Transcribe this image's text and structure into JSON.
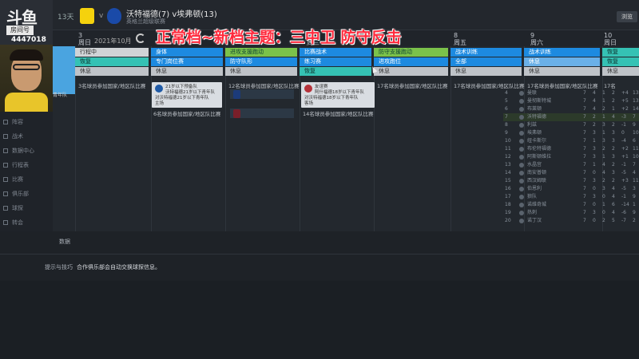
{
  "stream": {
    "site_logo": "斗鱼",
    "room_label": "房间号",
    "room_number": "4447018"
  },
  "header": {
    "days_label": "13天",
    "vs_label": "v",
    "match_title": "沃特福德(7) v埃弗顿(13)",
    "match_sub": "英格兰超级联赛",
    "browse_button": "浏览",
    "home_color": "#f5d20d",
    "away_color": "#1a4aa8"
  },
  "overlay": {
    "title": "正常档~新档主题：三中卫 防守反击",
    "color": "#ff2a3c"
  },
  "calendar": {
    "month": "2021年10月",
    "days": [
      {
        "num": "3",
        "weekday": "周日"
      },
      {
        "num": "6",
        "weekday": "周三"
      },
      {
        "num": "8",
        "weekday": "周五"
      },
      {
        "num": "9",
        "weekday": "周六"
      },
      {
        "num": "10",
        "weekday": "周日"
      }
    ],
    "faint_header": "6项数据"
  },
  "schedule": {
    "col0": [
      "行程中",
      "恢复",
      "休息"
    ],
    "col1": [
      "身体",
      "专门岗位赛",
      "休息"
    ],
    "col2": [
      "进攻支援跑动",
      "防守队形",
      "休息"
    ],
    "col3": [
      "比赛战术",
      "练习赛",
      "恢复"
    ],
    "col4": [
      "防守支援跑动",
      "进攻跑位",
      "休息"
    ],
    "col5": [
      "战术训练",
      "全部",
      "休息"
    ],
    "col6": [
      "战术训练",
      "休息",
      "休息"
    ],
    "col7": [
      "恢复",
      "恢复",
      "休息"
    ]
  },
  "info_rows": {
    "r0": "3名球员参加国家/地区队比赛",
    "r1": "12名球员参加国家/地区队比赛",
    "r2": "17名球员参加国家/地区队比赛",
    "r3": "17名球员参加国家/地区队比赛",
    "r4": "17名球员参加国家/地区队比赛",
    "r5": "17名球员参加国家/地区队比赛",
    "r6": "17名"
  },
  "popups": {
    "p1_line1": "21岁以下预备队",
    "p1_line2": "沃特福德21岁以下青年队",
    "p1_line3": "对沃特福德21岁以下青年队",
    "p1_line4": "主场",
    "p1_footer": "6名球员参加国家/地区队比赛",
    "p2_line1": "友谊赛",
    "p2_line2": "阿什福德18岁以下青年队",
    "p2_line3": "对沃特福德18岁以下青年队",
    "p2_line4": "客场",
    "p2_footer": "14名球员参加国家/地区队比赛"
  },
  "sidebar": {
    "selected_label": "青年队",
    "items": [
      "阵容",
      "战术",
      "数据中心",
      "行程表",
      "比赛",
      "俱乐部",
      "球探",
      "转会"
    ]
  },
  "league_table": {
    "rows": [
      {
        "pos": "4",
        "team": "曼联",
        "p": "7",
        "w": "4",
        "d": "1",
        "l": "2",
        "gd": "+4",
        "pts": "13"
      },
      {
        "pos": "5",
        "team": "曼彻斯特城",
        "p": "7",
        "w": "4",
        "d": "1",
        "l": "2",
        "gd": "+5",
        "pts": "13"
      },
      {
        "pos": "6",
        "team": "布莱顿",
        "p": "7",
        "w": "4",
        "d": "2",
        "l": "1",
        "gd": "+2",
        "pts": "14"
      },
      {
        "pos": "7",
        "team": "沃特福德",
        "p": "7",
        "w": "2",
        "d": "1",
        "l": "4",
        "gd": "-3",
        "pts": "7"
      },
      {
        "pos": "8",
        "team": "利兹",
        "p": "7",
        "w": "2",
        "d": "3",
        "l": "2",
        "gd": "-1",
        "pts": "9"
      },
      {
        "pos": "9",
        "team": "埃弗顿",
        "p": "7",
        "w": "3",
        "d": "1",
        "l": "3",
        "gd": "0",
        "pts": "10"
      },
      {
        "pos": "10",
        "team": "纽卡斯尔",
        "p": "7",
        "w": "1",
        "d": "3",
        "l": "3",
        "gd": "-4",
        "pts": "6"
      },
      {
        "pos": "11",
        "team": "布伦特福德",
        "p": "7",
        "w": "3",
        "d": "2",
        "l": "2",
        "gd": "+2",
        "pts": "11"
      },
      {
        "pos": "12",
        "team": "阿斯顿维拉",
        "p": "7",
        "w": "3",
        "d": "1",
        "l": "3",
        "gd": "+1",
        "pts": "10"
      },
      {
        "pos": "13",
        "team": "水晶宫",
        "p": "7",
        "w": "1",
        "d": "4",
        "l": "2",
        "gd": "-1",
        "pts": "7"
      },
      {
        "pos": "14",
        "team": "南安普顿",
        "p": "7",
        "w": "0",
        "d": "4",
        "l": "3",
        "gd": "-5",
        "pts": "4"
      },
      {
        "pos": "15",
        "team": "西汉姆联",
        "p": "7",
        "w": "3",
        "d": "2",
        "l": "2",
        "gd": "+3",
        "pts": "11"
      },
      {
        "pos": "16",
        "team": "伯恩利",
        "p": "7",
        "w": "0",
        "d": "3",
        "l": "4",
        "gd": "-5",
        "pts": "3"
      },
      {
        "pos": "17",
        "team": "狼队",
        "p": "7",
        "w": "3",
        "d": "0",
        "l": "4",
        "gd": "-1",
        "pts": "9"
      },
      {
        "pos": "18",
        "team": "诺维奇城",
        "p": "7",
        "w": "0",
        "d": "1",
        "l": "6",
        "gd": "-14",
        "pts": "1"
      },
      {
        "pos": "19",
        "team": "热刺",
        "p": "7",
        "w": "3",
        "d": "0",
        "l": "4",
        "gd": "-6",
        "pts": "9"
      },
      {
        "pos": "20",
        "team": "诺丁汉",
        "p": "7",
        "w": "0",
        "d": "2",
        "l": "5",
        "gd": "-7",
        "pts": "2"
      }
    ]
  },
  "lower": {
    "data_label": "数据",
    "tips_label": "提示与技巧",
    "tips_text": "合作俱乐部会自动交换球探信息。"
  }
}
